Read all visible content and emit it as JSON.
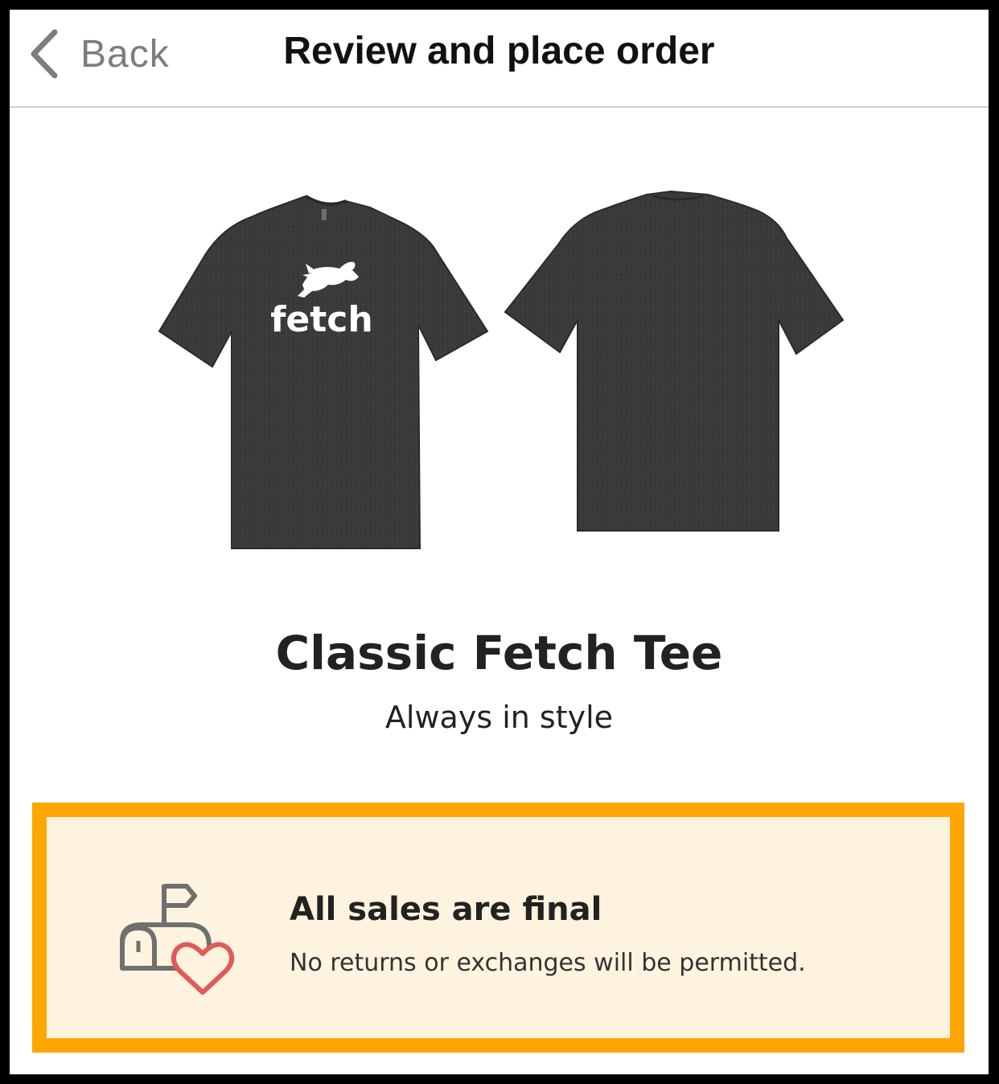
{
  "navbar": {
    "back_label": "Back",
    "title": "Review and place order"
  },
  "product": {
    "logo_text": "fetch",
    "name": "Classic Fetch Tee",
    "tagline": "Always in style",
    "shirt_color": "#3b3b3b"
  },
  "notice": {
    "title": "All sales are final",
    "text": "No returns or exchanges will be permitted.",
    "border_color": "#ffa700",
    "background_color": "#fdf3de",
    "icon": "mailbox-heart-icon"
  }
}
